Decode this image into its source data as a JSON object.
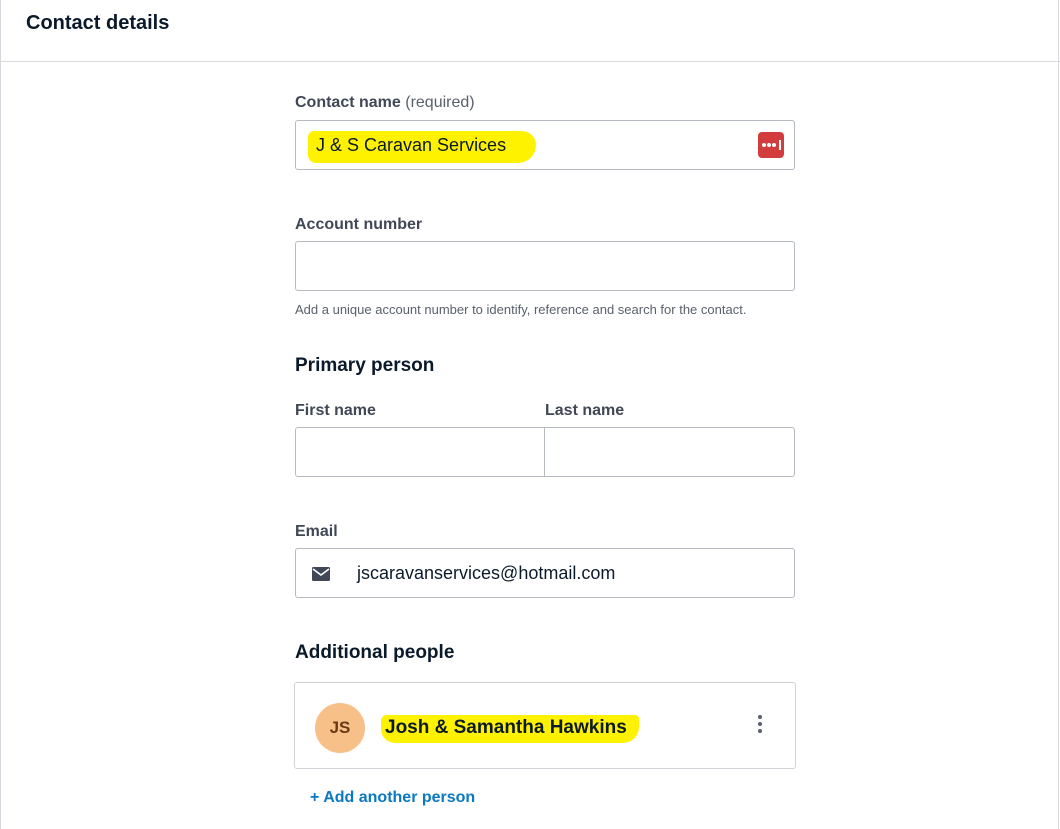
{
  "header": {
    "title": "Contact details"
  },
  "contact_name": {
    "label": "Contact name",
    "required_note": "(required)",
    "value": "J & S Caravan Services",
    "password_manager_icon": "password-manager-icon"
  },
  "account_number": {
    "label": "Account number",
    "value": "",
    "hint": "Add a unique account number to identify, reference and search for the contact."
  },
  "primary_person": {
    "title": "Primary person",
    "first_name_label": "First name",
    "first_name_value": "",
    "last_name_label": "Last name",
    "last_name_value": ""
  },
  "email": {
    "label": "Email",
    "icon": "envelope-icon",
    "value": "jscaravanservices@hotmail.com"
  },
  "additional_people": {
    "title": "Additional people",
    "people": [
      {
        "initials": "JS",
        "name": "Josh & Samantha Hawkins"
      }
    ],
    "add_label": "+ Add another person"
  },
  "colors": {
    "highlight": "#fff200",
    "avatar": "#f7c089",
    "link": "#0b78c2",
    "password_icon": "#d23c3c"
  }
}
